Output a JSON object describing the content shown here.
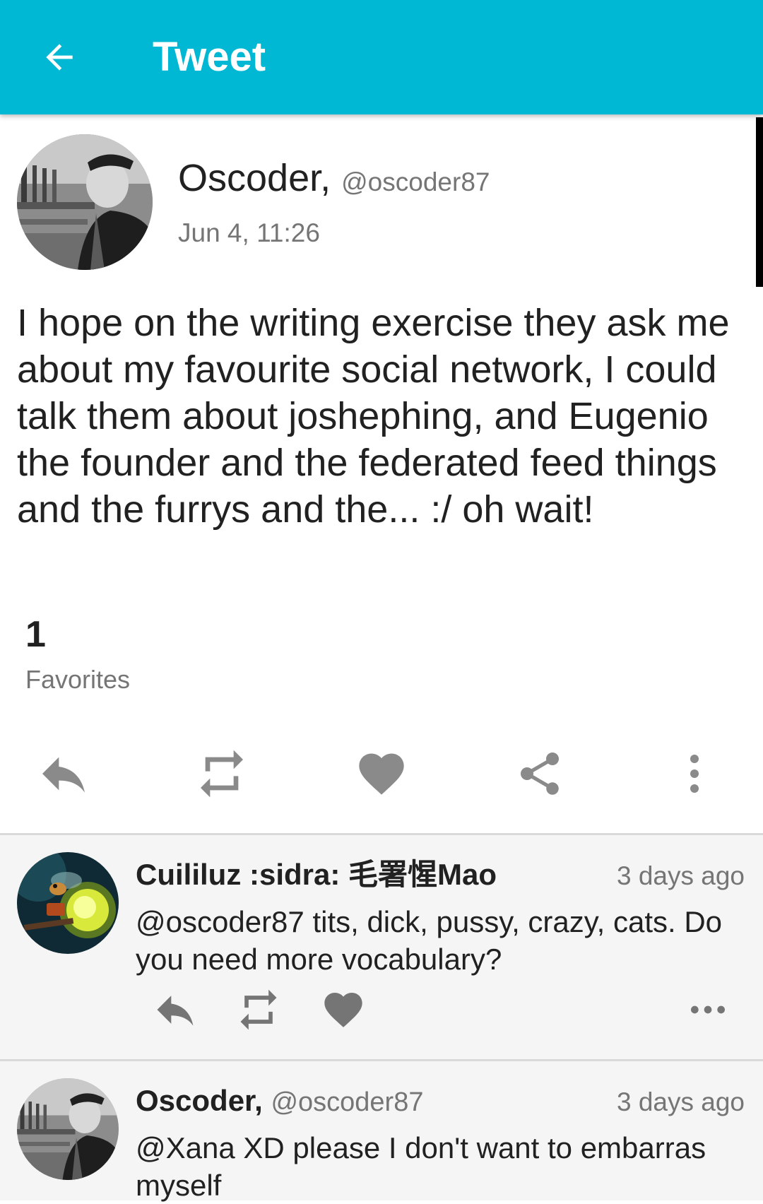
{
  "appbar": {
    "title": "Tweet",
    "back_icon": "arrow-back-icon",
    "color": "#00b8d4"
  },
  "post": {
    "author_name": "Oscoder,",
    "author_handle": "@oscoder87",
    "date": "Jun 4, 11:26",
    "text": "I hope on the writing exercise they ask me about my favourite social network, I could talk them about joshephing, and Eugenio the founder and the federated feed things and the furrys and the... :/ oh wait!",
    "favorites_count": "1",
    "favorites_label": "Favorites",
    "actions": [
      "reply-icon",
      "repeat-icon",
      "heart-icon",
      "share-icon",
      "more-vertical-icon"
    ]
  },
  "replies": [
    {
      "name": "Cuililuz :sidra: 毛署惺Mao",
      "handle": "",
      "time": "3 days ago",
      "text": "@oscoder87 tits, dick, pussy, crazy, cats. Do you need more vocabulary?",
      "actions": [
        "reply-icon",
        "repeat-icon",
        "heart-icon",
        "more-horizontal-icon"
      ]
    },
    {
      "name": "Oscoder,",
      "handle": "@oscoder87",
      "time": "3 days ago",
      "text": "@Xana XD please I don't want to embarras myself"
    }
  ]
}
